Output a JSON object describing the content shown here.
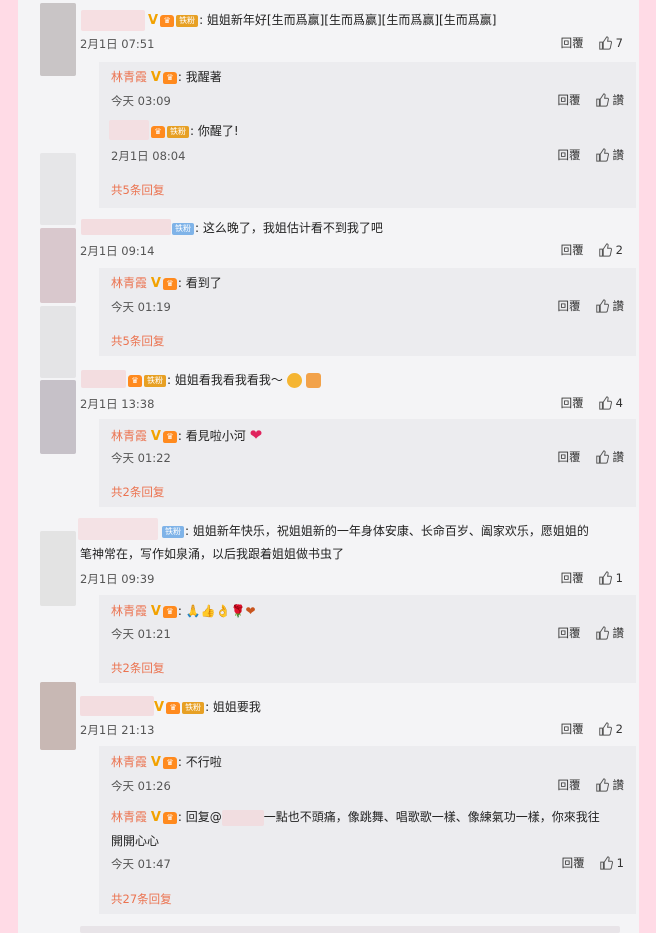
{
  "labels": {
    "reply": "回覆",
    "like": "讚",
    "fan_tag": "铁粉",
    "verified_name": "林青霞"
  },
  "comments": [
    {
      "text": "姐姐新年好[生而爲赢][生而爲赢][生而爲赢][生而爲赢]",
      "time": "2月1日 07:51",
      "likes": "7",
      "replies": [
        {
          "text": "我醒著",
          "time": "今天 03:09"
        },
        {
          "text": "你醒了!",
          "time": "2月1日 08:04"
        }
      ],
      "more": "共5条回复"
    },
    {
      "text": "这么晚了，我姐估计看不到我了吧",
      "time": "2月1日 09:14",
      "likes": "2",
      "replies": [
        {
          "text": "看到了",
          "time": "今天 01:19"
        }
      ],
      "more": "共5条回复"
    },
    {
      "text": "姐姐看我看我看我～",
      "time": "2月1日 13:38",
      "likes": "4",
      "replies": [
        {
          "text": "看見啦小河",
          "time": "今天 01:22"
        }
      ],
      "more": "共2条回复"
    },
    {
      "text_line1": "姐姐新年快乐，祝姐姐新的一年身体安康、长命百岁、阖家欢乐，愿姐姐的",
      "text_line2": "笔神常在，写作如泉涌，以后我跟着姐姐做书虫了",
      "time": "2月1日 09:39",
      "likes": "1",
      "replies": [
        {
          "text": "🙏👍👌🌹❤",
          "time": "今天 01:21"
        }
      ],
      "more": "共2条回复"
    },
    {
      "text": "姐姐要我",
      "time": "2月1日 21:13",
      "likes": "2",
      "replies": [
        {
          "text": "不行啦",
          "time": "今天 01:26"
        },
        {
          "text_prefix": "回复@",
          "text_rest": "一點也不頭痛，像跳舞、唱歌歌一樣、像練氣功一樣，你來我往",
          "text_line2": "開開心心",
          "time": "今天 01:47",
          "likes": "1"
        }
      ],
      "more": "共27条回复"
    }
  ]
}
